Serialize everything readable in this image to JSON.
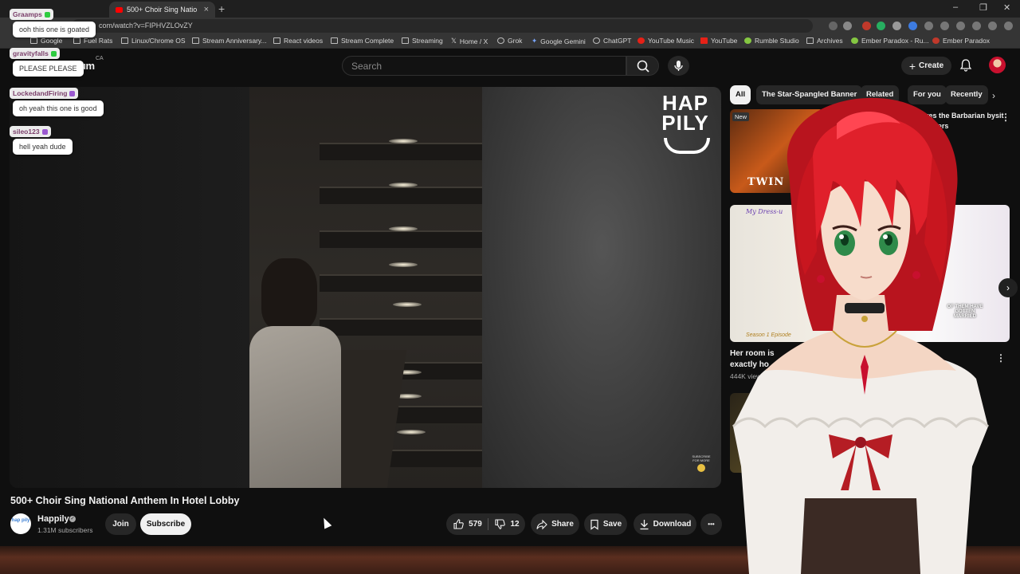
{
  "browser": {
    "tab_title": "500+ Choir Sing Natio",
    "tab_close": "×",
    "new_tab": "+",
    "window_controls": [
      "–",
      "❐",
      "✕"
    ],
    "url": "com/watch?v=FIPHVZLOvZY",
    "bookmarks": [
      "Google",
      "Fuel Rats",
      "Linux/Chrome OS",
      "Stream Anniversary...",
      "React videos",
      "Stream Complete",
      "Streaming",
      "Home / X",
      "Grok",
      "Google Gemini",
      "ChatGPT",
      "YouTube Music",
      "YouTube",
      "Rumble Studio",
      "Archives",
      "Ember Paradox - Ru...",
      "Ember Paradox"
    ]
  },
  "masthead": {
    "logo_partial": "um",
    "region": "CA",
    "search_placeholder": "Search",
    "create_label": "Create"
  },
  "video": {
    "watermark": "HAP PILY",
    "subscribe_watermark": "SUBSCRIBE FOR MORE",
    "title": "500+ Choir Sing National Anthem In Hotel Lobby",
    "channel": {
      "avatar_text": "hap pily",
      "name": "Happily",
      "subscribers": "1.31M subscribers"
    },
    "buttons": {
      "join": "Join",
      "subscribe": "Subscribe",
      "likes": "579",
      "dislikes": "12",
      "share": "Share",
      "save": "Save",
      "download": "Download",
      "more": "•••"
    }
  },
  "sidebar": {
    "chips": [
      "All",
      "The Star-Spangled Banner",
      "Related",
      "For you",
      "Recently"
    ],
    "rec1": {
      "badge": "New",
      "thumb_text": "TWIN",
      "title": "diot hires the Barbarian bysit | Twin Sitters"
    },
    "rec2": {
      "thumb_top": "My Dress-u",
      "thumb_bottom": "Season 1 Episode",
      "thumb_caption": "OF THEM HAVE GOTTEN MARRIED",
      "title": "Her room is exactly ho",
      "meta": "444K view"
    },
    "fragments": [
      "n",
      "ca",
      "ds",
      "ago"
    ]
  },
  "chat": [
    {
      "name": "Graamps",
      "msg": "ooh this one is goated",
      "badge_color": "#2ecc40"
    },
    {
      "name": "gravityfalls",
      "msg": "PLEASE PLEASE",
      "badge_color": "#2ecc40"
    },
    {
      "name": "LockedandFiring",
      "msg": "oh yeah this one is good",
      "badge_color": "#9b59d0"
    },
    {
      "name": "sileo123",
      "msg": "hell yeah dude",
      "badge_color": "#9b59d0"
    }
  ],
  "colors": {
    "yt_bg": "#0f0f0f",
    "yt_red": "#ff0000",
    "chip_bg": "#272727",
    "hair": "#d6202a"
  }
}
